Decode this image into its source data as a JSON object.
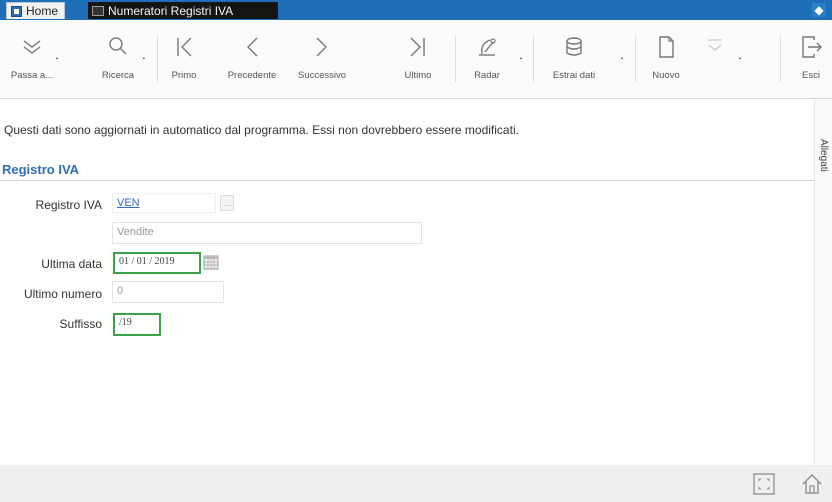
{
  "tabs": {
    "home": "Home",
    "active": "Numeratori Registri IVA",
    "window_control": "◆"
  },
  "toolbar": {
    "passa_a": "Passa a...",
    "ricerca": "Ricerca",
    "primo": "Primo",
    "precedente": "Precedente",
    "successivo": "Successivo",
    "ultimo": "Ultimo",
    "radar": "Radar",
    "estrai_dati": "Estrai dati",
    "nuovo": "Nuovo",
    "esci": "Esci",
    "dropdown_glyph": "˙"
  },
  "notice": "Questi dati sono aggiornati in automatico dal programma. Essi non dovrebbero essere modificati.",
  "side_tab": "Allegati",
  "section": {
    "title": "Registro IVA"
  },
  "form": {
    "registro_iva_label": "Registro IVA",
    "registro_iva_code": "VEN",
    "registro_iva_desc": "Vendite",
    "ultima_data_label": "Ultima data",
    "ultima_data_value": "01 / 01 / 2019",
    "ultimo_numero_label": "Ultimo numero",
    "ultimo_numero_value": "0",
    "suffisso_label": "Suffisso",
    "suffisso_value": "/19",
    "lookup_glyph": "…"
  },
  "colors": {
    "tabbar": "#1f6fb8",
    "accent": "#2f6db6",
    "highlight": "#3aa34a"
  }
}
